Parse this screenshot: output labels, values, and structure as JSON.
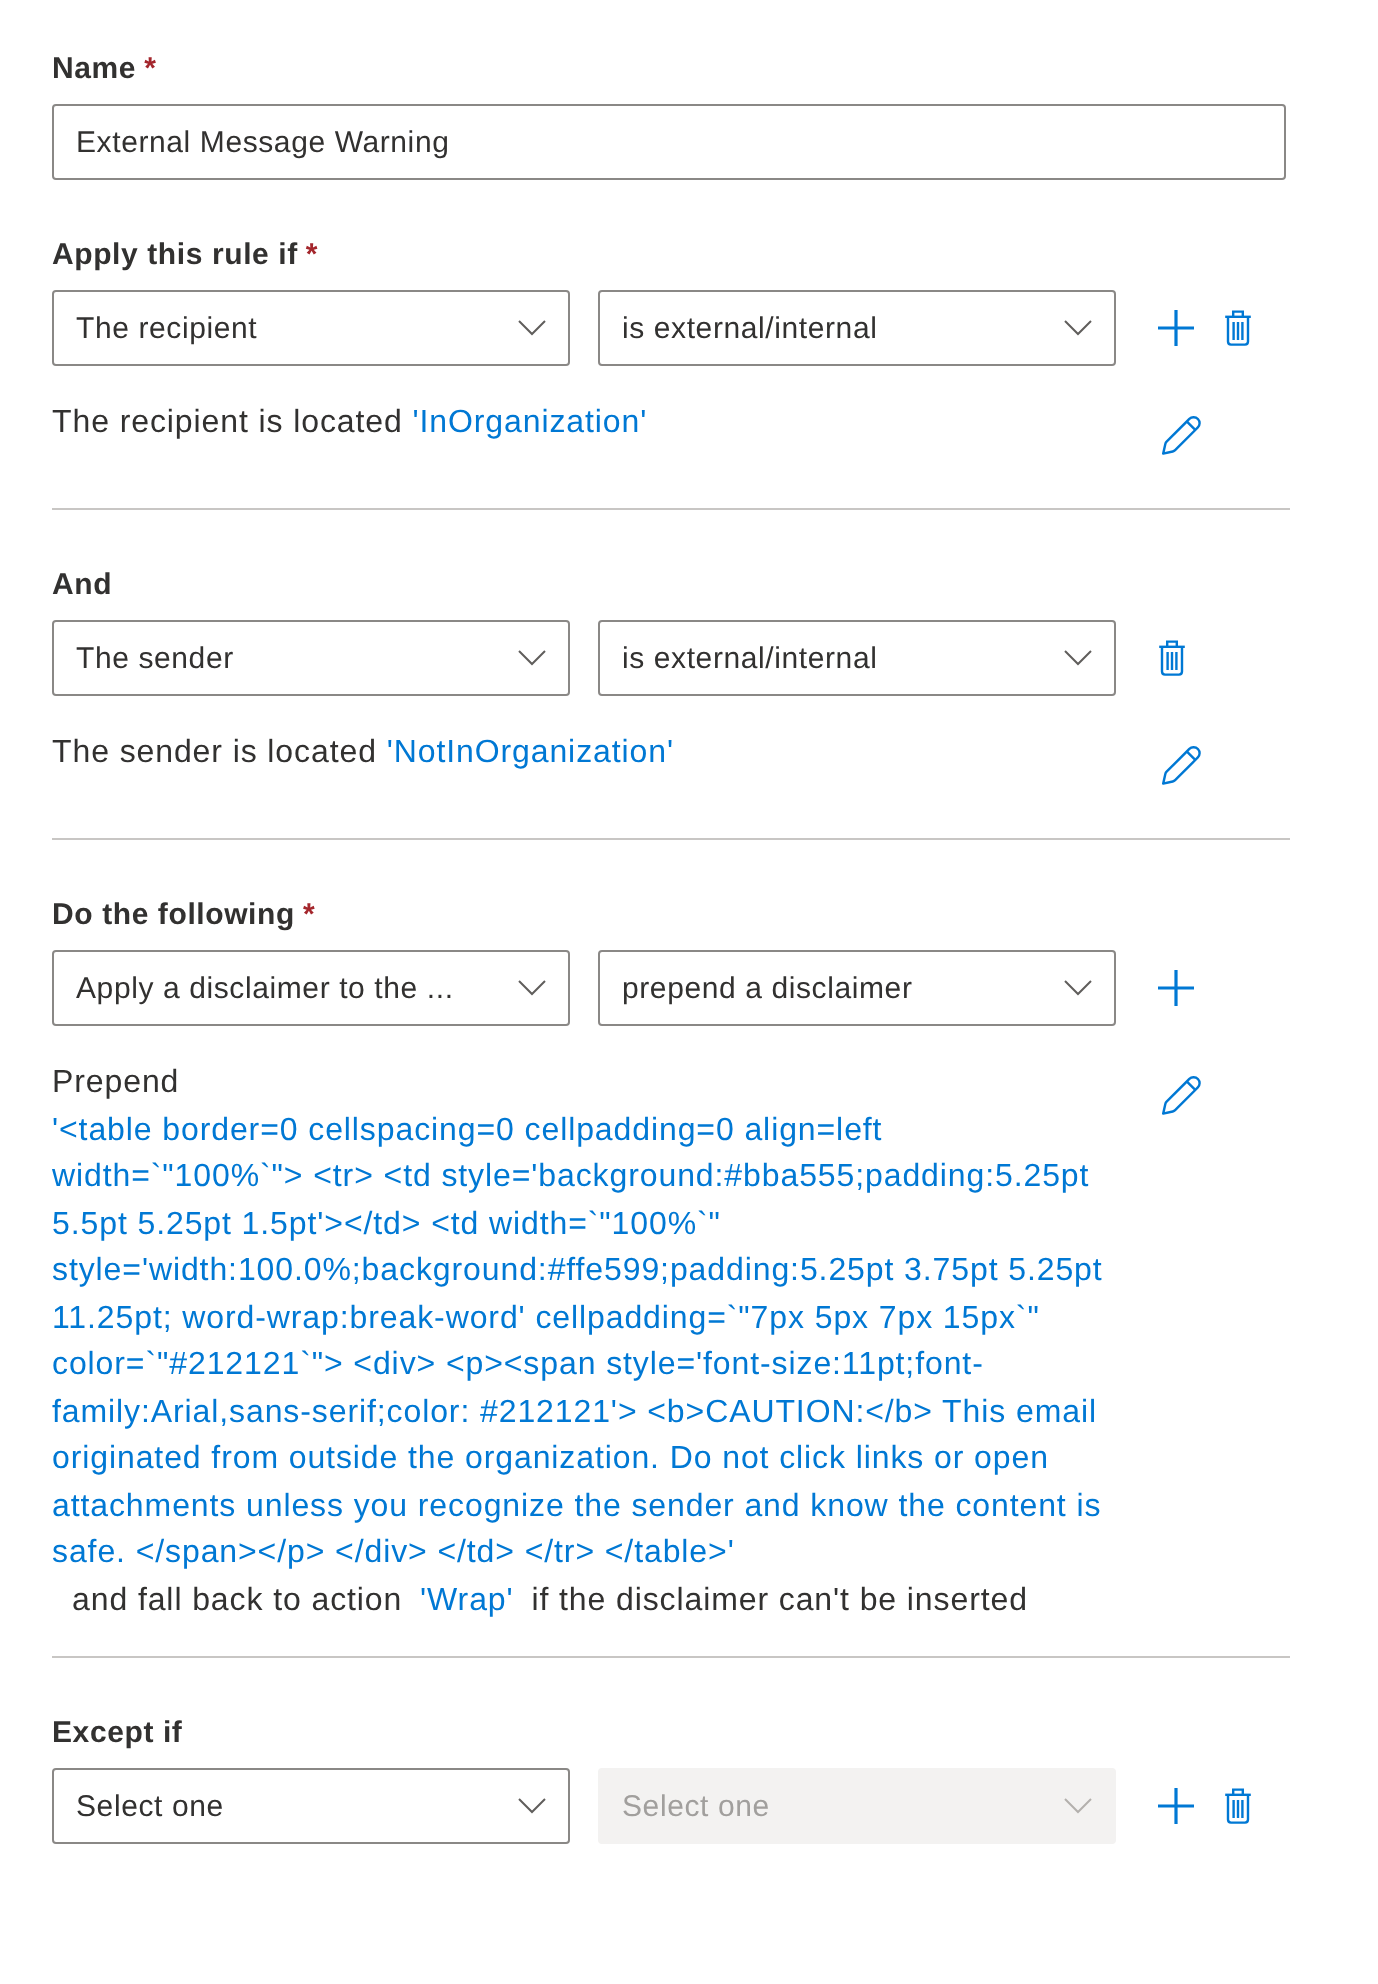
{
  "name_field": {
    "label": "Name",
    "required_mark": "*",
    "value": "External Message Warning"
  },
  "sections": [
    {
      "label": "Apply this rule if",
      "required_mark": "*",
      "dropdowns": [
        {
          "value": "The recipient",
          "disabled": false
        },
        {
          "value": "is external/internal",
          "disabled": false
        }
      ],
      "addable": true,
      "deletable": true,
      "editable": true,
      "summary": [
        {
          "parts": [
            {
              "kind": "plain",
              "text": "The recipient is located"
            },
            {
              "kind": "value",
              "text": "'InOrganization'"
            }
          ]
        }
      ]
    },
    {
      "label": "And",
      "dropdowns": [
        {
          "value": "The sender",
          "disabled": false
        },
        {
          "value": "is external/internal",
          "disabled": false
        }
      ],
      "addable": false,
      "deletable": true,
      "editable": true,
      "summary": [
        {
          "parts": [
            {
              "kind": "plain",
              "text": "The sender is located"
            },
            {
              "kind": "value",
              "text": "'NotInOrganization'"
            }
          ]
        }
      ]
    },
    {
      "label": "Do the following",
      "required_mark": "*",
      "dropdowns": [
        {
          "value": "Apply a disclaimer to the ...",
          "disabled": false
        },
        {
          "value": "prepend a disclaimer",
          "disabled": false
        }
      ],
      "addable": true,
      "deletable": false,
      "editable": true,
      "summary": [
        {
          "parts": [
            {
              "kind": "plain",
              "text": "Prepend"
            }
          ]
        },
        {
          "parts": [
            {
              "kind": "value",
              "text": "'<table border=0 cellspacing=0 cellpadding=0 align=left width=`\"100%`\"> <tr> <td style='background:#bba555;padding:5.25pt 5.5pt 5.25pt 1.5pt'></td> <td width=`\"100%`\" style='width:100.0%;background:#ffe599;padding:5.25pt 3.75pt 5.25pt 11.25pt; word-wrap:break-word' cellpadding=`\"7px 5px 7px 15px`\" color=`\"#212121`\"> <div> <p><span style='font-size:11pt;font-family:Arial,sans-serif;color: #212121'> <b>CAUTION:</b> This email originated from outside the organization. Do not click links or open attachments unless you recognize the sender and know the content is safe. </span></p> </div> </td> </tr> </table>'"
            }
          ]
        },
        {
          "parts": [
            {
              "kind": "plain",
              "text": "and fall back to action"
            },
            {
              "kind": "value",
              "text": "'Wrap'"
            },
            {
              "kind": "plain",
              "text": "if the disclaimer can't be inserted"
            }
          ]
        }
      ]
    },
    {
      "label": "Except if",
      "dropdowns": [
        {
          "value": "Select one",
          "disabled": false
        },
        {
          "value": "Select one",
          "disabled": true
        }
      ],
      "addable": true,
      "deletable": true,
      "editable": false
    }
  ]
}
